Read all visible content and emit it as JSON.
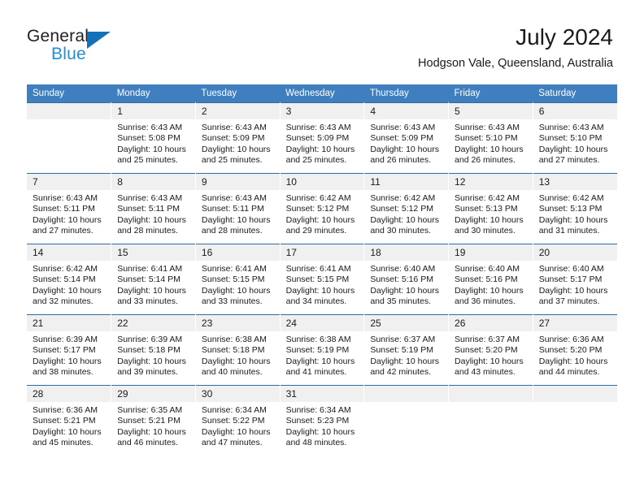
{
  "brand": {
    "name_dark": "General",
    "name_blue": "Blue",
    "triangle_color": "#1271b8",
    "blue_color": "#1f8fd6"
  },
  "header": {
    "title": "July 2024",
    "location": "Hodgson Vale, Queensland, Australia"
  },
  "theme": {
    "header_bg": "#3f7fbf",
    "row_divider": "#2b6ca3",
    "daynum_bg": "#f0f0f0",
    "text": "#1a1a1a"
  },
  "weekday_headers": [
    "Sunday",
    "Monday",
    "Tuesday",
    "Wednesday",
    "Thursday",
    "Friday",
    "Saturday"
  ],
  "labels": {
    "sunrise_prefix": "Sunrise:",
    "sunset_prefix": "Sunset:",
    "daylight_prefix": "Daylight:"
  },
  "weeks": [
    [
      {
        "day": "",
        "sunrise": "",
        "sunset": "",
        "daylight_line1": "",
        "daylight_line2": "",
        "empty": true
      },
      {
        "day": "1",
        "sunrise": "Sunrise: 6:43 AM",
        "sunset": "Sunset: 5:08 PM",
        "daylight_line1": "Daylight: 10 hours",
        "daylight_line2": "and 25 minutes."
      },
      {
        "day": "2",
        "sunrise": "Sunrise: 6:43 AM",
        "sunset": "Sunset: 5:09 PM",
        "daylight_line1": "Daylight: 10 hours",
        "daylight_line2": "and 25 minutes."
      },
      {
        "day": "3",
        "sunrise": "Sunrise: 6:43 AM",
        "sunset": "Sunset: 5:09 PM",
        "daylight_line1": "Daylight: 10 hours",
        "daylight_line2": "and 25 minutes."
      },
      {
        "day": "4",
        "sunrise": "Sunrise: 6:43 AM",
        "sunset": "Sunset: 5:09 PM",
        "daylight_line1": "Daylight: 10 hours",
        "daylight_line2": "and 26 minutes."
      },
      {
        "day": "5",
        "sunrise": "Sunrise: 6:43 AM",
        "sunset": "Sunset: 5:10 PM",
        "daylight_line1": "Daylight: 10 hours",
        "daylight_line2": "and 26 minutes."
      },
      {
        "day": "6",
        "sunrise": "Sunrise: 6:43 AM",
        "sunset": "Sunset: 5:10 PM",
        "daylight_line1": "Daylight: 10 hours",
        "daylight_line2": "and 27 minutes."
      }
    ],
    [
      {
        "day": "7",
        "sunrise": "Sunrise: 6:43 AM",
        "sunset": "Sunset: 5:11 PM",
        "daylight_line1": "Daylight: 10 hours",
        "daylight_line2": "and 27 minutes."
      },
      {
        "day": "8",
        "sunrise": "Sunrise: 6:43 AM",
        "sunset": "Sunset: 5:11 PM",
        "daylight_line1": "Daylight: 10 hours",
        "daylight_line2": "and 28 minutes."
      },
      {
        "day": "9",
        "sunrise": "Sunrise: 6:43 AM",
        "sunset": "Sunset: 5:11 PM",
        "daylight_line1": "Daylight: 10 hours",
        "daylight_line2": "and 28 minutes."
      },
      {
        "day": "10",
        "sunrise": "Sunrise: 6:42 AM",
        "sunset": "Sunset: 5:12 PM",
        "daylight_line1": "Daylight: 10 hours",
        "daylight_line2": "and 29 minutes."
      },
      {
        "day": "11",
        "sunrise": "Sunrise: 6:42 AM",
        "sunset": "Sunset: 5:12 PM",
        "daylight_line1": "Daylight: 10 hours",
        "daylight_line2": "and 30 minutes."
      },
      {
        "day": "12",
        "sunrise": "Sunrise: 6:42 AM",
        "sunset": "Sunset: 5:13 PM",
        "daylight_line1": "Daylight: 10 hours",
        "daylight_line2": "and 30 minutes."
      },
      {
        "day": "13",
        "sunrise": "Sunrise: 6:42 AM",
        "sunset": "Sunset: 5:13 PM",
        "daylight_line1": "Daylight: 10 hours",
        "daylight_line2": "and 31 minutes."
      }
    ],
    [
      {
        "day": "14",
        "sunrise": "Sunrise: 6:42 AM",
        "sunset": "Sunset: 5:14 PM",
        "daylight_line1": "Daylight: 10 hours",
        "daylight_line2": "and 32 minutes."
      },
      {
        "day": "15",
        "sunrise": "Sunrise: 6:41 AM",
        "sunset": "Sunset: 5:14 PM",
        "daylight_line1": "Daylight: 10 hours",
        "daylight_line2": "and 33 minutes."
      },
      {
        "day": "16",
        "sunrise": "Sunrise: 6:41 AM",
        "sunset": "Sunset: 5:15 PM",
        "daylight_line1": "Daylight: 10 hours",
        "daylight_line2": "and 33 minutes."
      },
      {
        "day": "17",
        "sunrise": "Sunrise: 6:41 AM",
        "sunset": "Sunset: 5:15 PM",
        "daylight_line1": "Daylight: 10 hours",
        "daylight_line2": "and 34 minutes."
      },
      {
        "day": "18",
        "sunrise": "Sunrise: 6:40 AM",
        "sunset": "Sunset: 5:16 PM",
        "daylight_line1": "Daylight: 10 hours",
        "daylight_line2": "and 35 minutes."
      },
      {
        "day": "19",
        "sunrise": "Sunrise: 6:40 AM",
        "sunset": "Sunset: 5:16 PM",
        "daylight_line1": "Daylight: 10 hours",
        "daylight_line2": "and 36 minutes."
      },
      {
        "day": "20",
        "sunrise": "Sunrise: 6:40 AM",
        "sunset": "Sunset: 5:17 PM",
        "daylight_line1": "Daylight: 10 hours",
        "daylight_line2": "and 37 minutes."
      }
    ],
    [
      {
        "day": "21",
        "sunrise": "Sunrise: 6:39 AM",
        "sunset": "Sunset: 5:17 PM",
        "daylight_line1": "Daylight: 10 hours",
        "daylight_line2": "and 38 minutes."
      },
      {
        "day": "22",
        "sunrise": "Sunrise: 6:39 AM",
        "sunset": "Sunset: 5:18 PM",
        "daylight_line1": "Daylight: 10 hours",
        "daylight_line2": "and 39 minutes."
      },
      {
        "day": "23",
        "sunrise": "Sunrise: 6:38 AM",
        "sunset": "Sunset: 5:18 PM",
        "daylight_line1": "Daylight: 10 hours",
        "daylight_line2": "and 40 minutes."
      },
      {
        "day": "24",
        "sunrise": "Sunrise: 6:38 AM",
        "sunset": "Sunset: 5:19 PM",
        "daylight_line1": "Daylight: 10 hours",
        "daylight_line2": "and 41 minutes."
      },
      {
        "day": "25",
        "sunrise": "Sunrise: 6:37 AM",
        "sunset": "Sunset: 5:19 PM",
        "daylight_line1": "Daylight: 10 hours",
        "daylight_line2": "and 42 minutes."
      },
      {
        "day": "26",
        "sunrise": "Sunrise: 6:37 AM",
        "sunset": "Sunset: 5:20 PM",
        "daylight_line1": "Daylight: 10 hours",
        "daylight_line2": "and 43 minutes."
      },
      {
        "day": "27",
        "sunrise": "Sunrise: 6:36 AM",
        "sunset": "Sunset: 5:20 PM",
        "daylight_line1": "Daylight: 10 hours",
        "daylight_line2": "and 44 minutes."
      }
    ],
    [
      {
        "day": "28",
        "sunrise": "Sunrise: 6:36 AM",
        "sunset": "Sunset: 5:21 PM",
        "daylight_line1": "Daylight: 10 hours",
        "daylight_line2": "and 45 minutes."
      },
      {
        "day": "29",
        "sunrise": "Sunrise: 6:35 AM",
        "sunset": "Sunset: 5:21 PM",
        "daylight_line1": "Daylight: 10 hours",
        "daylight_line2": "and 46 minutes."
      },
      {
        "day": "30",
        "sunrise": "Sunrise: 6:34 AM",
        "sunset": "Sunset: 5:22 PM",
        "daylight_line1": "Daylight: 10 hours",
        "daylight_line2": "and 47 minutes."
      },
      {
        "day": "31",
        "sunrise": "Sunrise: 6:34 AM",
        "sunset": "Sunset: 5:23 PM",
        "daylight_line1": "Daylight: 10 hours",
        "daylight_line2": "and 48 minutes."
      },
      {
        "day": "",
        "sunrise": "",
        "sunset": "",
        "daylight_line1": "",
        "daylight_line2": "",
        "empty": true
      },
      {
        "day": "",
        "sunrise": "",
        "sunset": "",
        "daylight_line1": "",
        "daylight_line2": "",
        "empty": true
      },
      {
        "day": "",
        "sunrise": "",
        "sunset": "",
        "daylight_line1": "",
        "daylight_line2": "",
        "empty": true
      }
    ]
  ]
}
